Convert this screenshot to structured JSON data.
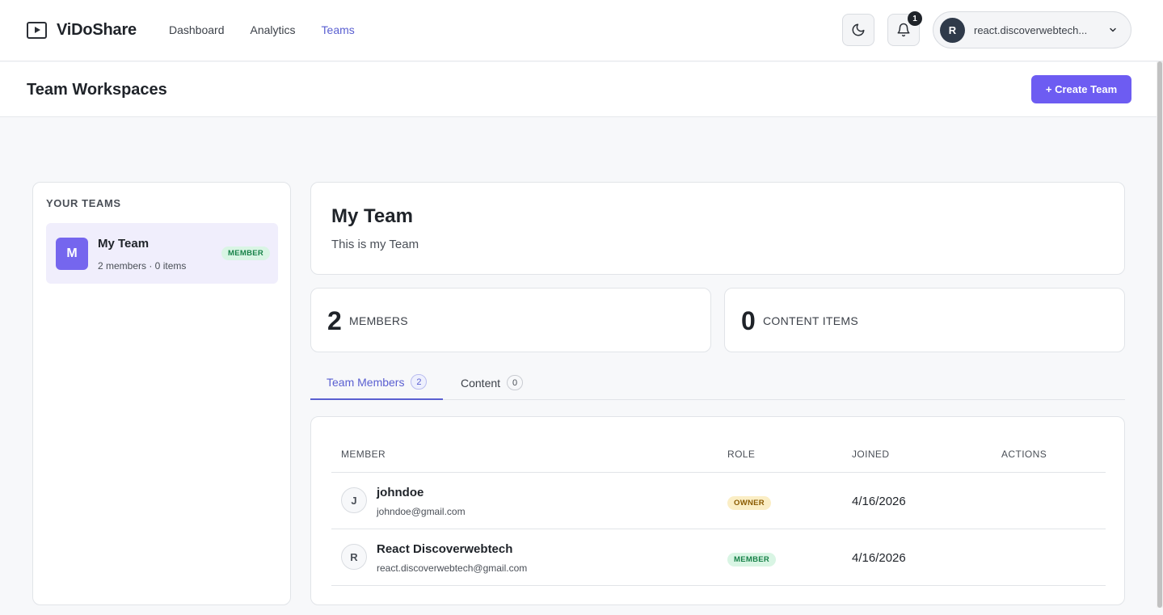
{
  "app": {
    "brand": "ViDoShare"
  },
  "nav": {
    "items": [
      {
        "label": "Dashboard"
      },
      {
        "label": "Analytics"
      },
      {
        "label": "Teams"
      }
    ],
    "active": "Teams"
  },
  "topbar": {
    "theme_icon": "moon-icon",
    "bell_icon": "bell-icon",
    "notification_count": "1",
    "user": {
      "initial": "R",
      "name": "react.discoverwebtech..."
    }
  },
  "header": {
    "title": "Team Workspaces",
    "create_label": "+ Create Team"
  },
  "sidebar": {
    "title": "YOUR TEAMS",
    "teams": [
      {
        "initial": "M",
        "name": "My Team",
        "meta": "2 members · 0 items",
        "role": "MEMBER"
      }
    ]
  },
  "team": {
    "name": "My Team",
    "description": "This is my Team"
  },
  "stats": {
    "members": {
      "value": "2",
      "label": "MEMBERS"
    },
    "content": {
      "value": "0",
      "label": "CONTENT ITEMS"
    }
  },
  "tabs": [
    {
      "label": "Team Members",
      "count": "2"
    },
    {
      "label": "Content",
      "count": "0"
    }
  ],
  "table": {
    "headers": [
      "MEMBER",
      "ROLE",
      "JOINED",
      "ACTIONS"
    ],
    "rows": [
      {
        "initial": "J",
        "name": "johndoe",
        "email": "johndoe@gmail.com",
        "role": "OWNER",
        "joined": "4/16/2026"
      },
      {
        "initial": "R",
        "name": "React Discoverwebtech",
        "email": "react.discoverwebtech@gmail.com",
        "role": "MEMBER",
        "joined": "4/16/2026"
      }
    ]
  },
  "colors": {
    "accent": "#6d5cf2",
    "active_link": "#5a5fd1",
    "member_badge": "#d9f5e4",
    "owner_badge": "#fbeec5"
  }
}
